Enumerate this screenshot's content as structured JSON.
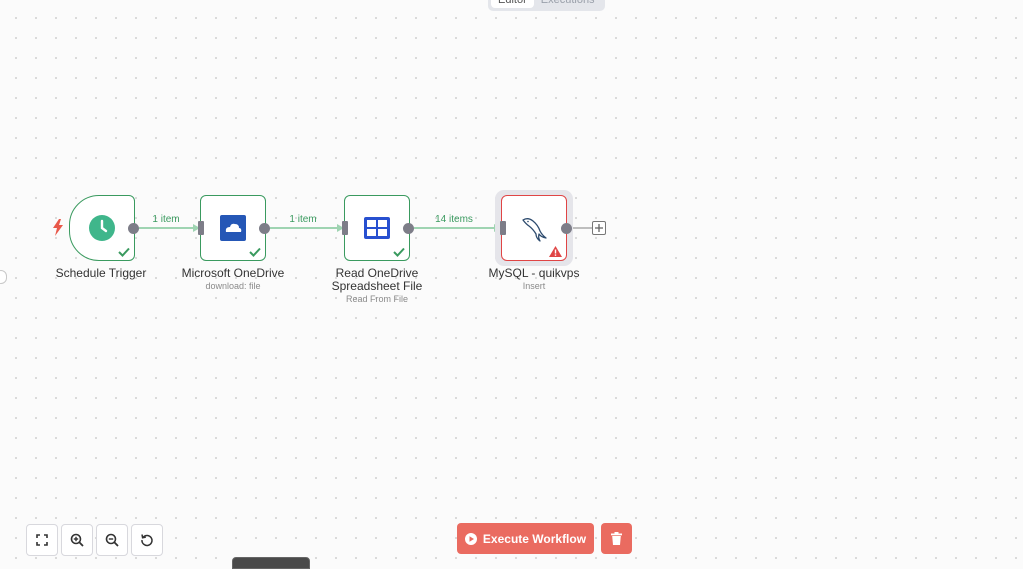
{
  "header": {
    "tabs": [
      {
        "label": "Editor",
        "active": true
      },
      {
        "label": "Executions",
        "active": false
      }
    ]
  },
  "nodes": [
    {
      "title": "Schedule Trigger",
      "subtitle": "",
      "status": "success",
      "icon": "clock-icon",
      "color": "#3fb68b"
    },
    {
      "title": "Microsoft OneDrive",
      "subtitle": "download: file",
      "status": "success",
      "icon": "onedrive-icon",
      "color": "#2557b6"
    },
    {
      "title": "Read OneDrive",
      "title2": "Spreadsheet File",
      "subtitle": "Read From File",
      "status": "success",
      "icon": "spreadsheet-icon",
      "color": "#2850d0"
    },
    {
      "title": "MySQL - quikvps",
      "subtitle": "Insert",
      "status": "error",
      "icon": "mysql-dolphin-icon",
      "color": "#2d4b6e"
    }
  ],
  "edges": [
    {
      "label": "1 item"
    },
    {
      "label": "1 item"
    },
    {
      "label": "14 items"
    }
  ],
  "toolbar": {
    "execute_label": "Execute Workflow",
    "icons": [
      "fit-view-icon",
      "zoom-in-icon",
      "zoom-out-icon",
      "reset-zoom-icon",
      "trash-icon"
    ]
  },
  "colors": {
    "success": "#3a9a5f",
    "error": "#e04545",
    "accent": "#ea6b60",
    "trigger_bolt": "#e8584a"
  }
}
